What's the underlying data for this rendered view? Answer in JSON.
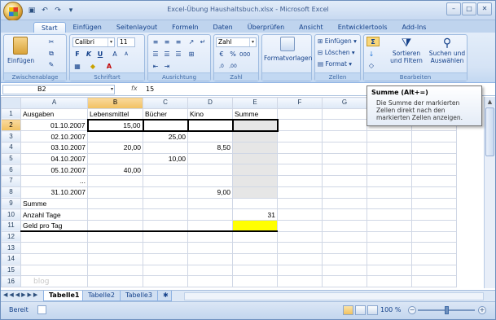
{
  "window": {
    "title": "Excel-Übung Haushaltsbuch.xlsx - Microsoft Excel",
    "controls": [
      "–",
      "□",
      "✕"
    ]
  },
  "ribbon_tabs": [
    "Start",
    "Einfügen",
    "Seitenlayout",
    "Formeln",
    "Daten",
    "Überprüfen",
    "Ansicht",
    "Entwicklertools",
    "Add-Ins"
  ],
  "ribbon": {
    "clipboard": {
      "paste_label": "Einfügen",
      "group_label": "Zwischenablage"
    },
    "font": {
      "font_name": "Calibri",
      "font_size": "11",
      "bold": "F",
      "italic": "K",
      "underline": "U",
      "group_label": "Schriftart"
    },
    "alignment": {
      "group_label": "Ausrichtung"
    },
    "number": {
      "format": "Zahl",
      "group_label": "Zahl"
    },
    "styles": {
      "format_templates": "Formatvorlagen"
    },
    "cells": {
      "insert": "Einfügen",
      "delete": "Löschen",
      "format": "Format",
      "group_label": "Zellen"
    },
    "editing": {
      "sort_filter": "Sortieren und Filtern",
      "find_select": "Suchen und Auswählen",
      "group_label": "Bearbeiten"
    }
  },
  "formula_bar": {
    "cell_ref": "B2",
    "fx": "fx",
    "value": "15"
  },
  "tooltip": {
    "title": "Summe (Alt+=)",
    "description": "Die Summe der markierten Zellen direkt nach den markierten Zellen anzeigen."
  },
  "columns": [
    "A",
    "B",
    "C",
    "D",
    "E",
    "F",
    "G",
    "H",
    "I"
  ],
  "rows": [
    [
      "Ausgaben",
      "Lebensmittel",
      "Bücher",
      "Kino",
      "Summe",
      "",
      "",
      "",
      ""
    ],
    [
      "01.10.2007",
      "15,00",
      "",
      "",
      "",
      "",
      "",
      "",
      ""
    ],
    [
      "02.10.2007",
      "",
      "25,00",
      "",
      "",
      "",
      "",
      "",
      ""
    ],
    [
      "03.10.2007",
      "20,00",
      "",
      "8,50",
      "",
      "",
      "",
      "",
      ""
    ],
    [
      "04.10.2007",
      "",
      "10,00",
      "",
      "",
      "",
      "",
      "",
      ""
    ],
    [
      "05.10.2007",
      "40,00",
      "",
      "",
      "",
      "",
      "",
      "",
      ""
    ],
    [
      "...",
      "",
      "",
      "",
      "",
      "",
      "",
      "",
      ""
    ],
    [
      "31.10.2007",
      "",
      "",
      "9,00",
      "",
      "",
      "",
      "",
      ""
    ],
    [
      "Summe",
      "",
      "",
      "",
      "",
      "",
      "",
      "",
      ""
    ],
    [
      "Anzahl Tage",
      "",
      "",
      "",
      "31",
      "",
      "",
      "",
      ""
    ],
    [
      "Geld pro Tag",
      "",
      "",
      "",
      "",
      "",
      "",
      "",
      ""
    ],
    [
      "",
      "",
      "",
      "",
      "",
      "",
      "",
      "",
      ""
    ],
    [
      "",
      "",
      "",
      "",
      "",
      "",
      "",
      "",
      ""
    ],
    [
      "",
      "",
      "",
      "",
      "",
      "",
      "",
      "",
      ""
    ],
    [
      "",
      "",
      "",
      "",
      "",
      "",
      "",
      "",
      ""
    ],
    [
      "",
      "",
      "",
      "",
      "",
      "",
      "",
      "",
      ""
    ]
  ],
  "sheet_tabs": [
    "Tabelle1",
    "Tabelle2",
    "Tabelle3"
  ],
  "status": {
    "ready": "Bereit",
    "zoom": "100 %"
  },
  "watermark": "blog"
}
